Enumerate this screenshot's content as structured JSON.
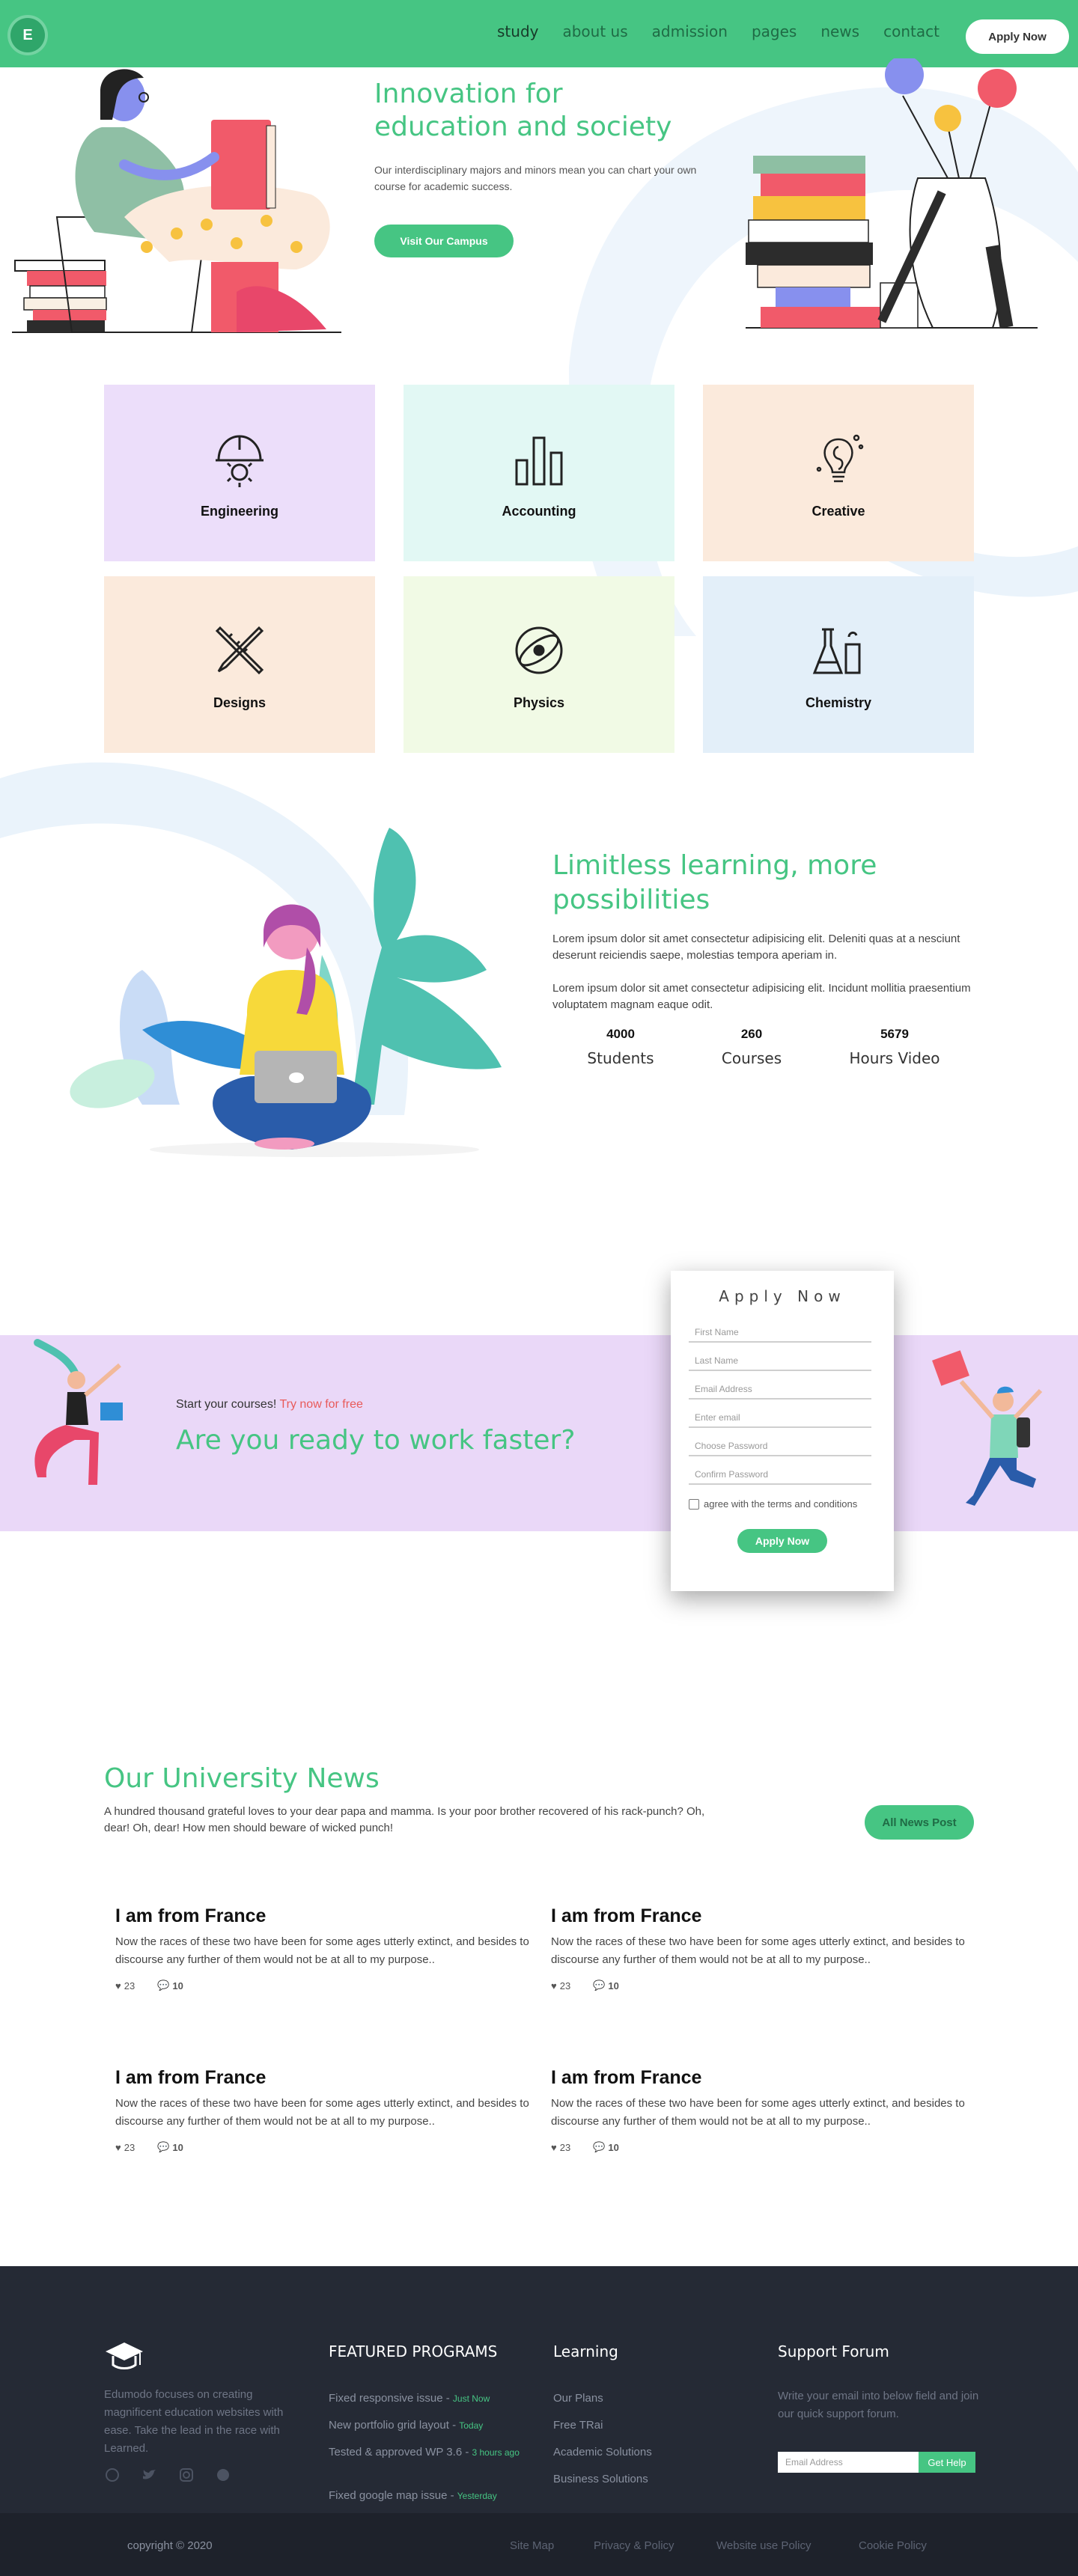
{
  "header": {
    "logo_letter": "E",
    "nav": [
      "study",
      "about us",
      "admission",
      "pages",
      "news",
      "contact"
    ],
    "apply_label": "Apply Now"
  },
  "hero": {
    "title_line1": "Innovation for",
    "title_line2": "education and society",
    "text": "Our interdisciplinary majors and minors mean you can chart your own course for academic success.",
    "button": "Visit Our Campus"
  },
  "categories": [
    {
      "label": "Engineering",
      "icon": "helmet-gear-icon",
      "bg": "#ecdefa"
    },
    {
      "label": "Accounting",
      "icon": "bar-chart-icon",
      "bg": "#e2f8f4"
    },
    {
      "label": "Creative",
      "icon": "lightbulb-icon",
      "bg": "#fbeadc"
    },
    {
      "label": "Designs",
      "icon": "pencil-ruler-icon",
      "bg": "#fbeadc"
    },
    {
      "label": "Physics",
      "icon": "atom-icon",
      "bg": "#f1fae5"
    },
    {
      "label": "Chemistry",
      "icon": "flask-icon",
      "bg": "#e3eff9"
    }
  ],
  "limitless": {
    "title_line1": "Limitless learning, more",
    "title_line2": "possibilities",
    "p1": "Lorem ipsum dolor sit amet consectetur adipisicing elit. Deleniti quas at a nesciunt deserunt reiciendis saepe, molestias tempora aperiam in.",
    "p2": "Lorem ipsum dolor sit amet consectetur adipisicing elit. Incidunt mollitia praesentium voluptatem magnam eaque odit.",
    "stats": [
      {
        "num": "4000",
        "label": "Students"
      },
      {
        "num": "260",
        "label": "Courses"
      },
      {
        "num": "5679",
        "label": "Hours Video"
      }
    ]
  },
  "promo": {
    "small_prefix": "Start your courses!",
    "small_link": "Try now for free",
    "big": "Are you ready to work faster?"
  },
  "form": {
    "title": "Apply Now",
    "fields": [
      "First Name",
      "Last Name",
      "Email Address",
      "Enter email",
      "Choose Password",
      "Confirm Password"
    ],
    "agree": "agree with the terms and conditions",
    "button": "Apply Now"
  },
  "news": {
    "title": "Our University News",
    "subtitle": "A hundred thousand grateful loves to your dear papa and mamma. Is your poor brother recovered of his rack-punch? Oh, dear! Oh, dear! How men should beware of wicked punch!",
    "button": "All News Post",
    "posts": [
      {
        "title": "I am from France",
        "text": "Now the races of these two have been for some ages utterly extinct, and besides to discourse any further of them would not be at all to my purpose..",
        "likes": "23",
        "comments": "10"
      },
      {
        "title": "I am from France",
        "text": "Now the races of these two have been for some ages utterly extinct, and besides to discourse any further of them would not be at all to my purpose..",
        "likes": "23",
        "comments": "10"
      },
      {
        "title": "I am from France",
        "text": "Now the races of these two have been for some ages utterly extinct, and besides to discourse any further of them would not be at all to my purpose..",
        "likes": "23",
        "comments": "10"
      },
      {
        "title": "I am from France",
        "text": "Now the races of these two have been for some ages utterly extinct, and besides to discourse any further of them would not be at all to my purpose..",
        "likes": "23",
        "comments": "10"
      }
    ]
  },
  "footer": {
    "about": "Edumodo focuses on creating magnificent education websites with ease. Take the lead in the race with Learned.",
    "featured_title": "FEATURED PROGRAMS",
    "featured": [
      {
        "text": "Fixed responsive issue -",
        "tag": "Just Now"
      },
      {
        "text": "New portfolio grid layout -",
        "tag": "Today"
      },
      {
        "text": "Tested & approved WP 3.6 -",
        "tag": "3 hours ago"
      },
      {
        "text": "Fixed google map issue -",
        "tag": "Yesterday"
      }
    ],
    "learning_title": "Learning",
    "learning": [
      "Our Plans",
      "Free TRai",
      "Academic Solutions",
      "Business Solutions"
    ],
    "support_title": "Support Forum",
    "support_text": "Write your email into below field and join our quick support forum.",
    "email_placeholder": "Email Address",
    "help_button": "Get Help",
    "copyright": "copyright © 2020",
    "bottom_links": [
      "Site Map",
      "Privacy & Policy",
      "Website use Policy",
      "Cookie Policy"
    ]
  },
  "colors": {
    "brand_green": "#46c583",
    "footer_dark": "#252a35",
    "promo_lilac": "#ead8f8"
  }
}
